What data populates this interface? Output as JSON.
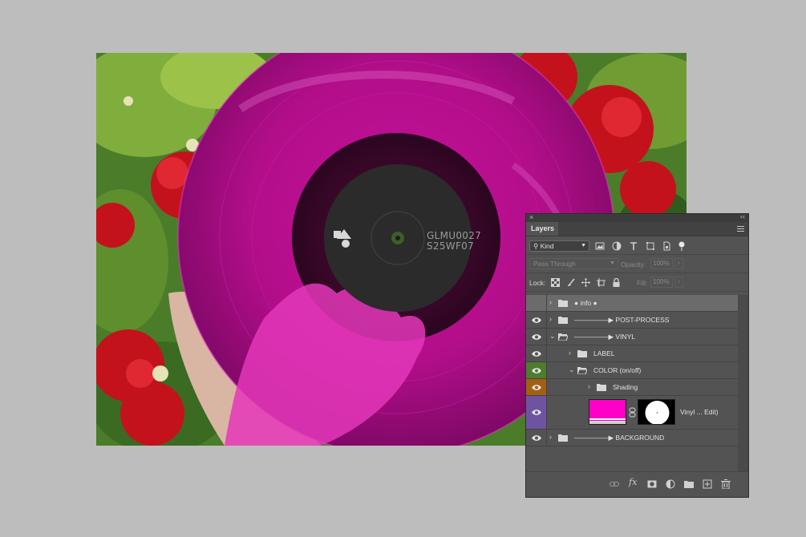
{
  "artwork": {
    "record_label_line1": "GLMU0027",
    "record_label_line2": "S25WF07"
  },
  "panel": {
    "tab_label": "Layers",
    "filter": {
      "kind_value": "Kind"
    },
    "blend": {
      "mode_value": "Pass Through",
      "opacity_label": "Opacity:",
      "opacity_value": "100%"
    },
    "lock": {
      "label": "Lock:",
      "fill_label": "Fill:",
      "fill_value": "100%"
    },
    "layers": [
      {
        "name": "● info ●",
        "visible": false,
        "color": "none"
      },
      {
        "name": "—————▶ POST-PROCESS",
        "visible": true,
        "color": "none"
      },
      {
        "name": "—————▶ VINYL",
        "visible": true,
        "color": "none"
      },
      {
        "name": "LABEL",
        "visible": true,
        "color": "none"
      },
      {
        "name": "COLOR (on/off)",
        "visible": true,
        "color": "green"
      },
      {
        "name": "Shading",
        "visible": true,
        "color": "orange"
      },
      {
        "name": "Vinyl ... Edit)",
        "visible": true,
        "color": "purple"
      },
      {
        "name": "—————▶ BACKGROUND",
        "visible": true,
        "color": "none"
      }
    ],
    "colors": {
      "fill_thumbnail": "#ff00c8",
      "green_tag": "#4e7b2f",
      "orange_tag": "#a35f14",
      "purple_tag": "#6e54a0"
    },
    "bottom_icons": [
      "link-icon",
      "fx-icon",
      "mask-icon",
      "adjustment-icon",
      "new-group-icon",
      "new-layer-icon",
      "trash-icon"
    ],
    "bottom_fx_label": "fx"
  }
}
